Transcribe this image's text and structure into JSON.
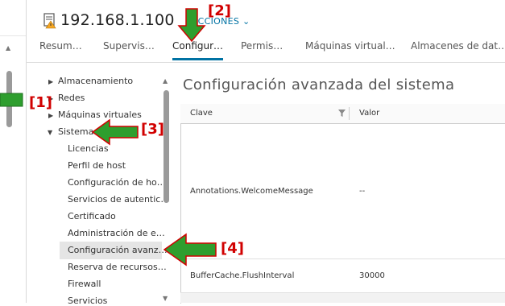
{
  "header": {
    "host_title": "192.168.1.100",
    "actions_label": "ACCIONES ⌄"
  },
  "tabs": [
    {
      "label": "Resum…",
      "active": false
    },
    {
      "label": "Supervis…",
      "active": false
    },
    {
      "label": "Configur…",
      "active": true
    },
    {
      "label": "Permis…",
      "active": false
    },
    {
      "label": "Máquinas virtual…",
      "active": false
    },
    {
      "label": "Almacenes de dat…",
      "active": false
    }
  ],
  "tree": {
    "items": [
      {
        "label": "Almacenamiento",
        "level": 0,
        "caret": "collapsed"
      },
      {
        "label": "Redes",
        "level": 0,
        "caret": "collapsed"
      },
      {
        "label": "Máquinas virtuales",
        "level": 0,
        "caret": "collapsed"
      },
      {
        "label": "Sistema",
        "level": 0,
        "caret": "expanded"
      },
      {
        "label": "Licencias",
        "level": 1
      },
      {
        "label": "Perfil de host",
        "level": 1
      },
      {
        "label": "Configuración de ho…",
        "level": 1
      },
      {
        "label": "Servicios de autentic…",
        "level": 1
      },
      {
        "label": "Certificado",
        "level": 1
      },
      {
        "label": "Administración de e…",
        "level": 1
      },
      {
        "label": "Configuración avanz…",
        "level": 1,
        "selected": true
      },
      {
        "label": "Reserva de recursos…",
        "level": 1
      },
      {
        "label": "Firewall",
        "level": 1
      },
      {
        "label": "Servicios",
        "level": 1
      }
    ]
  },
  "content": {
    "title": "Configuración avanzada del sistema",
    "columns": [
      "Clave",
      "Valor"
    ],
    "rows": [
      {
        "key": "Annotations.WelcomeMessage",
        "value": "--"
      },
      {
        "key": "BufferCache.FlushInterval",
        "value": "30000"
      }
    ]
  },
  "annotations": [
    {
      "label": "[1]",
      "color": "#d10000"
    },
    {
      "label": "[2]",
      "color": "#d10000"
    },
    {
      "label": "[3]",
      "color": "#d10000"
    },
    {
      "label": "[4]",
      "color": "#d10000"
    }
  ],
  "colors": {
    "accent": "#0072a3",
    "arrow_green": "#2e9e2e",
    "arrow_outline": "#d10000",
    "warning_icon": "#f5a623"
  }
}
